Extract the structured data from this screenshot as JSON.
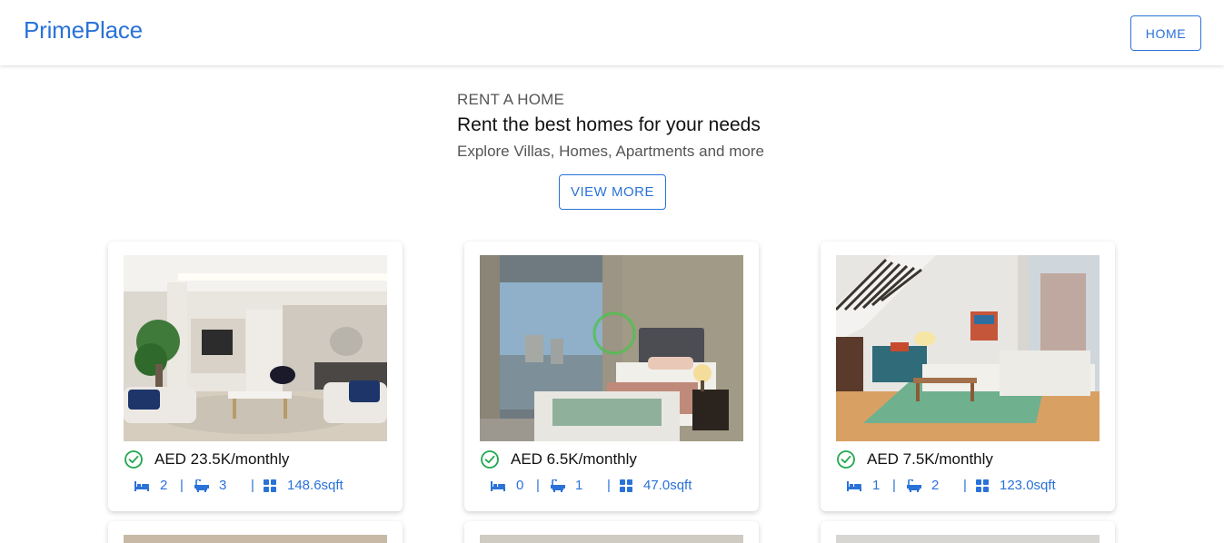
{
  "navbar": {
    "brand": "PrimePlace",
    "home_label": "HOME"
  },
  "hero": {
    "eyebrow": "RENT A HOME",
    "title": "Rent the best homes for your needs",
    "subtitle": "Explore Villas, Homes, Apartments and more",
    "cta_label": "VIEW MORE"
  },
  "colors": {
    "accent": "#2a72d8",
    "verified": "#1fa84f"
  },
  "listings": [
    {
      "price": "AED 23.5K/monthly",
      "bedrooms": "2",
      "bathrooms": "3",
      "area": "148.6sqft",
      "image": "living-room-photo"
    },
    {
      "price": "AED 6.5K/monthly",
      "bedrooms": "0",
      "bathrooms": "1",
      "area": "47.0sqft",
      "image": "bedroom-photo"
    },
    {
      "price": "AED 7.5K/monthly",
      "bedrooms": "1",
      "bathrooms": "2",
      "area": "123.0sqft",
      "image": "loft-living-room-photo"
    }
  ],
  "icons": {
    "verified": "check-circle-icon",
    "bed": "bed-icon",
    "bath": "bathtub-icon",
    "area": "grid-icon"
  }
}
